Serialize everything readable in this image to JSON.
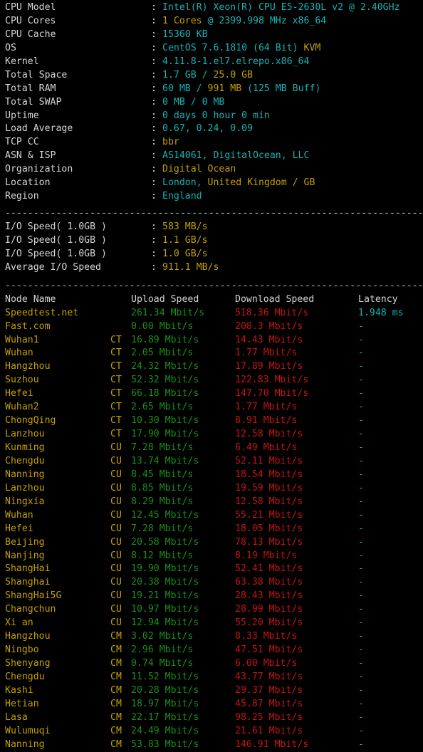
{
  "system_info": [
    {
      "label": "CPU Model",
      "segments": [
        {
          "text": "Intel(R) Xeon(R) CPU E5-2630L v2 @ 2.40GHz",
          "color": "cyan"
        }
      ]
    },
    {
      "label": "CPU Cores",
      "segments": [
        {
          "text": "1 Cores",
          "color": "yellow"
        },
        {
          "text": " @ 2399.998 MHz x86_64",
          "color": "cyan"
        }
      ]
    },
    {
      "label": "CPU Cache",
      "segments": [
        {
          "text": "15360 KB",
          "color": "cyan"
        }
      ]
    },
    {
      "label": "OS",
      "segments": [
        {
          "text": "CentOS 7.6.1810 (64 Bit) ",
          "color": "cyan"
        },
        {
          "text": "KVM",
          "color": "yellow"
        }
      ]
    },
    {
      "label": "Kernel",
      "segments": [
        {
          "text": "4.11.8-1.el7.elrepo.x86_64",
          "color": "cyan"
        }
      ]
    },
    {
      "label": "Total Space",
      "segments": [
        {
          "text": "1.7 GB / ",
          "color": "cyan"
        },
        {
          "text": "25.0 GB",
          "color": "yellow"
        }
      ]
    },
    {
      "label": "Total RAM",
      "segments": [
        {
          "text": "60 MB / ",
          "color": "cyan"
        },
        {
          "text": "991 MB",
          "color": "yellow"
        },
        {
          "text": " (125 MB Buff)",
          "color": "cyan"
        }
      ]
    },
    {
      "label": "Total SWAP",
      "segments": [
        {
          "text": "0 MB / 0 MB",
          "color": "cyan"
        }
      ]
    },
    {
      "label": "Uptime",
      "segments": [
        {
          "text": "0 days 0 hour 0 min",
          "color": "cyan"
        }
      ]
    },
    {
      "label": "Load Average",
      "segments": [
        {
          "text": "0.67, 0.24, 0.09",
          "color": "cyan"
        }
      ]
    },
    {
      "label": "TCP CC",
      "segments": [
        {
          "text": "bbr",
          "color": "yellow"
        }
      ]
    },
    {
      "label": "ASN & ISP",
      "segments": [
        {
          "text": "AS14061, DigitalOcean, LLC",
          "color": "cyan"
        }
      ]
    },
    {
      "label": "Organization",
      "segments": [
        {
          "text": "Digital Ocean",
          "color": "yellow"
        }
      ]
    },
    {
      "label": "Location",
      "segments": [
        {
          "text": "London, ",
          "color": "cyan"
        },
        {
          "text": "United Kingdom / GB",
          "color": "yellow"
        }
      ]
    },
    {
      "label": "Region",
      "segments": [
        {
          "text": "England",
          "color": "cyan"
        }
      ]
    }
  ],
  "io_section": [
    {
      "label": "I/O Speed( 1.0GB )",
      "value": "583 MB/s"
    },
    {
      "label": "I/O Speed( 1.0GB )",
      "value": "1.1 GB/s"
    },
    {
      "label": "I/O Speed( 1.0GB )",
      "value": "1.0 GB/s"
    },
    {
      "label": "Average I/O Speed",
      "value": "911.1 MB/s"
    }
  ],
  "speedtest": {
    "headers": {
      "node": "Node Name",
      "isp": "",
      "upload": "Upload Speed",
      "download": "Download Speed",
      "latency": "Latency"
    },
    "rows": [
      {
        "node": "Speedtest.net",
        "isp": "",
        "upload": "261.34 Mbit/s",
        "download": "518.36 Mbit/s",
        "latency": "1.948 ms"
      },
      {
        "node": "Fast.com",
        "isp": "",
        "upload": "0.00 Mbit/s",
        "download": "208.3 Mbit/s",
        "latency": "-"
      },
      {
        "node": "Wuhan1",
        "isp": "CT",
        "upload": "16.89 Mbit/s",
        "download": "14.43 Mbit/s",
        "latency": "-"
      },
      {
        "node": "Wuhan",
        "isp": "CT",
        "upload": "2.05 Mbit/s",
        "download": "1.77 Mbit/s",
        "latency": "-"
      },
      {
        "node": "Hangzhou",
        "isp": "CT",
        "upload": "24.32 Mbit/s",
        "download": "17.89 Mbit/s",
        "latency": "-"
      },
      {
        "node": "Suzhou",
        "isp": "CT",
        "upload": "52.32 Mbit/s",
        "download": "122.83 Mbit/s",
        "latency": "-"
      },
      {
        "node": "Hefei",
        "isp": "CT",
        "upload": "66.18 Mbit/s",
        "download": "147.70 Mbit/s",
        "latency": "-"
      },
      {
        "node": "Wuhan2",
        "isp": "CT",
        "upload": "2.65 Mbit/s",
        "download": "1.77 Mbit/s",
        "latency": "-"
      },
      {
        "node": "ChongQing",
        "isp": "CT",
        "upload": "10.30 Mbit/s",
        "download": "8.91 Mbit/s",
        "latency": "-"
      },
      {
        "node": "Lanzhou",
        "isp": "CT",
        "upload": "17.90 Mbit/s",
        "download": "12.58 Mbit/s",
        "latency": "-"
      },
      {
        "node": "Kunming",
        "isp": "CU",
        "upload": "7.28 Mbit/s",
        "download": "6.49 Mbit/s",
        "latency": "-"
      },
      {
        "node": "Chengdu",
        "isp": "CU",
        "upload": "13.74 Mbit/s",
        "download": "52.11 Mbit/s",
        "latency": "-"
      },
      {
        "node": "Nanning",
        "isp": "CU",
        "upload": "8.45 Mbit/s",
        "download": "18.54 Mbit/s",
        "latency": "-"
      },
      {
        "node": "Lanzhou",
        "isp": "CU",
        "upload": "8.85 Mbit/s",
        "download": "19.59 Mbit/s",
        "latency": "-"
      },
      {
        "node": "Ningxia",
        "isp": "CU",
        "upload": "8.29 Mbit/s",
        "download": "12.58 Mbit/s",
        "latency": "-"
      },
      {
        "node": "Wuhan",
        "isp": "CU",
        "upload": "12.45 Mbit/s",
        "download": "55.21 Mbit/s",
        "latency": "-"
      },
      {
        "node": "Hefei",
        "isp": "CU",
        "upload": "7.28 Mbit/s",
        "download": "18.05 Mbit/s",
        "latency": "-"
      },
      {
        "node": "Beijing",
        "isp": "CU",
        "upload": "20.58 Mbit/s",
        "download": "78.13 Mbit/s",
        "latency": "-"
      },
      {
        "node": "Nanjing",
        "isp": "CU",
        "upload": "8.12 Mbit/s",
        "download": "8.19 Mbit/s",
        "latency": "-"
      },
      {
        "node": "ShangHai",
        "isp": "CU",
        "upload": "19.90 Mbit/s",
        "download": "52.41 Mbit/s",
        "latency": "-"
      },
      {
        "node": "Shanghai",
        "isp": "CU",
        "upload": "20.38 Mbit/s",
        "download": "63.38 Mbit/s",
        "latency": "-"
      },
      {
        "node": "ShangHai5G",
        "isp": "CU",
        "upload": "19.21 Mbit/s",
        "download": "28.43 Mbit/s",
        "latency": "-"
      },
      {
        "node": "Changchun",
        "isp": "CU",
        "upload": "10.97 Mbit/s",
        "download": "28.99 Mbit/s",
        "latency": "-"
      },
      {
        "node": "Xi an",
        "isp": "CU",
        "upload": "12.94 Mbit/s",
        "download": "55.20 Mbit/s",
        "latency": "-"
      },
      {
        "node": "Hangzhou",
        "isp": "CM",
        "upload": "3.02 Mbit/s",
        "download": "8.33 Mbit/s",
        "latency": "-"
      },
      {
        "node": "Ningbo",
        "isp": "CM",
        "upload": "2.96 Mbit/s",
        "download": "47.51 Mbit/s",
        "latency": "-"
      },
      {
        "node": "Shenyang",
        "isp": "CM",
        "upload": "0.74 Mbit/s",
        "download": "6.00 Mbit/s",
        "latency": "-"
      },
      {
        "node": "Chengdu",
        "isp": "CM",
        "upload": "11.52 Mbit/s",
        "download": "43.77 Mbit/s",
        "latency": "-"
      },
      {
        "node": "Kashi",
        "isp": "CM",
        "upload": "20.28 Mbit/s",
        "download": "29.37 Mbit/s",
        "latency": "-"
      },
      {
        "node": "Hetian",
        "isp": "CM",
        "upload": "18.97 Mbit/s",
        "download": "45.87 Mbit/s",
        "latency": "-"
      },
      {
        "node": "Lasa",
        "isp": "CM",
        "upload": "22.17 Mbit/s",
        "download": "98.25 Mbit/s",
        "latency": "-"
      },
      {
        "node": "Wulumuqi",
        "isp": "CM",
        "upload": "24.49 Mbit/s",
        "download": "21.61 Mbit/s",
        "latency": "-"
      },
      {
        "node": "Nanning",
        "isp": "CM",
        "upload": "53.83 Mbit/s",
        "download": "146.91 Mbit/s",
        "latency": "-"
      }
    ]
  },
  "separator": {
    "text": "-------------------------------------------------------------------------------------"
  },
  "colors": {
    "background": "#000000",
    "label": "#d6d6d6",
    "cyan": "#18b2b2",
    "yellow": "#c2a000",
    "green": "#1a8f1a",
    "red": "#c61414",
    "separator": "#bfbfbf"
  }
}
